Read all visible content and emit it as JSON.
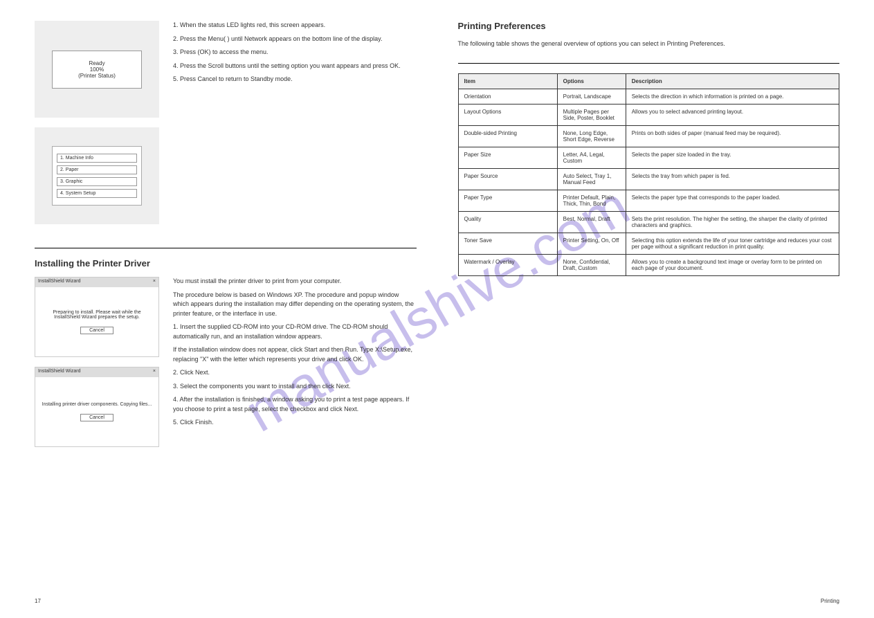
{
  "watermark": "manualshive.com",
  "left": {
    "lcd1": {
      "line1": "Ready",
      "line2": "100%",
      "line3": "(Printer Status)"
    },
    "lcd2": {
      "items": [
        "1. Machine Info",
        "2. Paper",
        "3. Graphic",
        "4. System Setup"
      ]
    },
    "step1": "1. When the status LED lights red, this screen appears.",
    "step2": "2. Press the Menu( ) until Network appears on the bottom line of the display.",
    "step3": "3. Press (OK) to access the menu.",
    "step4": "4. Press the Scroll buttons until the setting option you want appears and press OK.",
    "step5": "5. Press Cancel to return to Standby mode.",
    "section2": {
      "title": "Installing the Printer Driver",
      "p1": "You must install the printer driver to print from your computer.",
      "p2": "The procedure below is based on Windows XP. The procedure and popup window which appears during the installation may differ depending on the operating system, the printer feature, or the interface in use.",
      "p3": "1. Insert the supplied CD-ROM into your CD-ROM drive. The CD-ROM should automatically run, and an installation window appears.",
      "p4": "If the installation window does not appear, click Start and then Run. Type X:\\Setup.exe, replacing \"X\" with the letter which represents your drive and click OK.",
      "p5": "2. Click Next.",
      "p6": "3. Select the components you want to install and then click Next.",
      "p7": "4. After the installation is finished, a window asking you to print a test page appears. If you choose to print a test page, select the checkbox and click Next.",
      "p8": "5. Click Finish."
    },
    "dlg1": {
      "title": "InstallShield Wizard",
      "body": "Preparing to install. Please wait while the InstallShield Wizard prepares the setup.",
      "btn": "Cancel"
    },
    "dlg2": {
      "title": "InstallShield Wizard",
      "body": "Installing printer driver components. Copying files...",
      "btn": "Cancel"
    }
  },
  "right": {
    "title": "Printing Preferences",
    "intro": "The following table shows the general overview of options you can select in Printing Preferences.",
    "headers": [
      "Item",
      "Options",
      "Description"
    ],
    "rows": [
      [
        "Orientation",
        "Portrait, Landscape",
        "Selects the direction in which information is printed on a page."
      ],
      [
        "Layout Options",
        "Multiple Pages per Side, Poster, Booklet",
        "Allows you to select advanced printing layout."
      ],
      [
        "Double-sided Printing",
        "None, Long Edge, Short Edge, Reverse",
        "Prints on both sides of paper (manual feed may be required)."
      ],
      [
        "Paper Size",
        "Letter, A4, Legal, Custom",
        "Selects the paper size loaded in the tray."
      ],
      [
        "Paper Source",
        "Auto Select, Tray 1, Manual Feed",
        "Selects the tray from which paper is fed."
      ],
      [
        "Paper Type",
        "Printer Default, Plain, Thick, Thin, Bond",
        "Selects the paper type that corresponds to the paper loaded."
      ],
      [
        "Quality",
        "Best, Normal, Draft",
        "Sets the print resolution. The higher the setting, the sharper the clarity of printed characters and graphics."
      ],
      [
        "Toner Save",
        "Printer Setting, On, Off",
        "Selecting this option extends the life of your toner cartridge and reduces your cost per page without a significant reduction in print quality."
      ],
      [
        "Watermark / Overlay",
        "None, Confidential, Draft, Custom",
        "Allows you to create a background text image or overlay form to be printed on each page of your document."
      ]
    ]
  },
  "footer": {
    "page": "17",
    "title": "Printing"
  }
}
